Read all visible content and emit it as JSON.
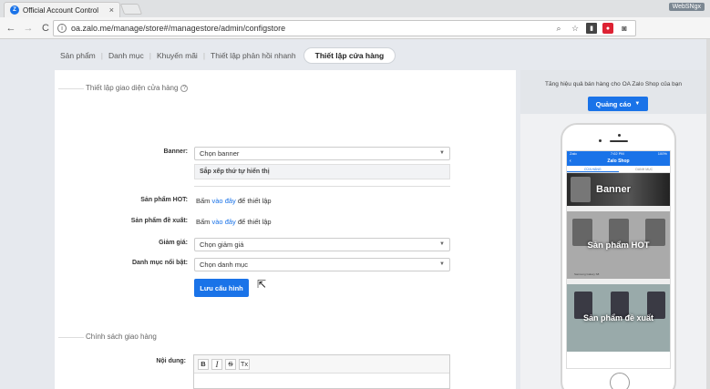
{
  "browser": {
    "tab_title": "Official Account Control",
    "tab_close": "×",
    "profile": "WebSNgx",
    "address": "oa.zalo.me/manage/store#/managestore/admin/configstore",
    "nav": {
      "back": "←",
      "forward": "→",
      "reload": "C"
    }
  },
  "subnav": {
    "items": [
      "Sản phẩm",
      "Danh mục",
      "Khuyến mãi",
      "Thiết lập phản hồi nhanh"
    ],
    "active": "Thiết lập cửa hàng"
  },
  "display_section": {
    "title": "Thiết lập giao diện cửa hàng",
    "banner_label": "Banner:",
    "banner_value": "Chọn banner",
    "sort_label": "Sắp xếp thứ tự hiển thị",
    "hot_label": "Sản phẩm HOT:",
    "hot_text_pre": "Bấm",
    "hot_link": "vào đây",
    "hot_text_post": "để thiết lập",
    "rec_label": "Sản phẩm đề xuất:",
    "rec_text_pre": "Bấm",
    "rec_link": "vào đây",
    "rec_text_post": "để thiết lập",
    "discount_label": "Giảm giá:",
    "discount_value": "Chọn giảm giá",
    "category_label": "Danh mục nổi bật:",
    "category_value": "Chọn danh mục",
    "save_button": "Lưu cấu hình"
  },
  "shipping_section": {
    "title": "Chính sách giao hàng",
    "content_label": "Nội dung:",
    "editor_buttons": [
      "B",
      "I",
      "S",
      "Tx"
    ]
  },
  "promo": {
    "text": "Tăng hiệu quả bán hàng cho OA Zalo Shop của bạn",
    "ad_button": "Quảng cáo",
    "phone": {
      "status_left": "Zalo",
      "status_time": "7:02 PM",
      "status_right": "100%",
      "header": "Zalo Shop",
      "tab_1": "CỬA HÀNG",
      "tab_2": "DANH MỤC",
      "banner": "Banner",
      "hot": "Sản phẩm HOT",
      "recommended": "Sản phẩm đề xuất",
      "hot_caption": "Samsung Galaxy S8"
    }
  }
}
